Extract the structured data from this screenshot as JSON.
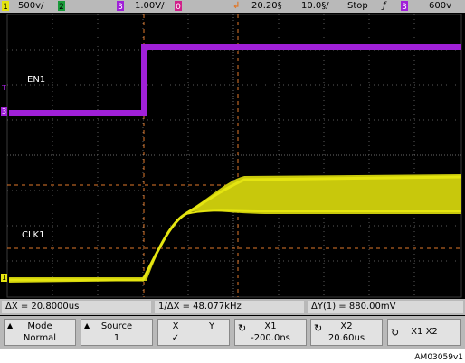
{
  "topbar": {
    "ch1_num": "1",
    "ch1_scale": "500ⅴ/",
    "ch2_num": "2",
    "ch3_num": "3",
    "ch3_scale": "1.00V/",
    "ch4_num": "0",
    "trigger_pos": "20.20§",
    "timebase": "10.0§/",
    "run_state": "Stop",
    "trig_slope": "ƒ",
    "trig_ch": "3",
    "trig_level": "600ⅴ"
  },
  "labels": {
    "en1": "EN1",
    "clk1": "CLK1",
    "ch3_marker": "3",
    "ch1_marker": "1",
    "t_marker": "T"
  },
  "measurements": {
    "delta_x": "ΔX = 20.8000us",
    "inv_delta_x": "1/ΔX = 48.077kHz",
    "delta_y": "ΔY(1) = 880.00mV"
  },
  "softkeys": {
    "mode_label": "Mode",
    "mode_value": "Normal",
    "source_label": "Source",
    "source_value": "1",
    "x_label": "X",
    "y_label": "Y",
    "xy_check": "✓",
    "x1_label": "X1",
    "x1_value": "-200.0ns",
    "x2_label": "X2",
    "x2_value": "20.60us",
    "x1x2_label": "X1 X2"
  },
  "figure_ref": "AM03059v1",
  "colors": {
    "ch1": "#e5e510",
    "ch3": "#a020d8",
    "cursor": "#e0782a"
  }
}
